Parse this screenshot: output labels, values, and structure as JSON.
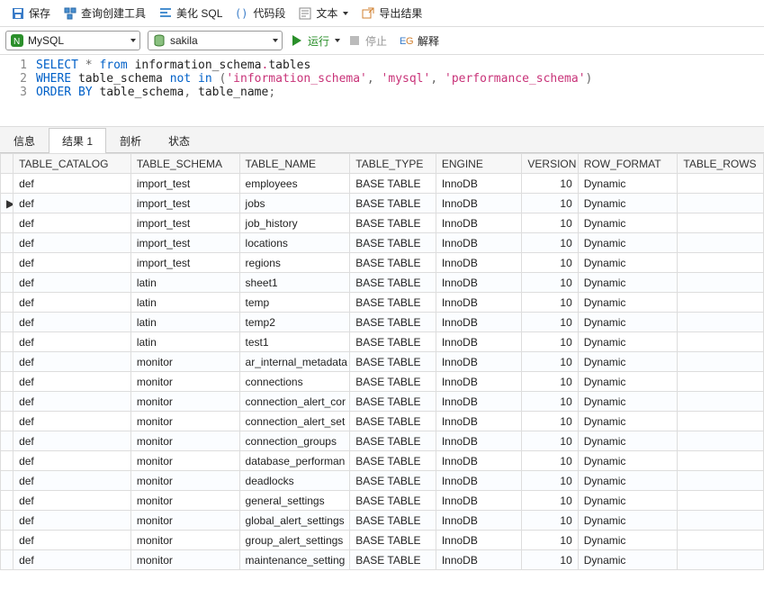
{
  "toolbar": {
    "save": "保存",
    "query_builder": "查询创建工具",
    "beautify_sql": "美化 SQL",
    "code_snippet": "代码段",
    "text": "文本",
    "export_result": "导出结果"
  },
  "row2": {
    "db_type": "MySQL",
    "schema": "sakila",
    "run": "运行",
    "stop": "停止",
    "explain": "解释"
  },
  "sql": {
    "lines": [
      {
        "n": "1",
        "tokens": [
          [
            "kw",
            "SELECT"
          ],
          [
            "op",
            " * "
          ],
          [
            "kw",
            "from"
          ],
          [
            "ident",
            " information_schema"
          ],
          [
            "sym",
            "."
          ],
          [
            "ident",
            "tables"
          ]
        ]
      },
      {
        "n": "2",
        "tokens": [
          [
            "kw",
            "WHERE"
          ],
          [
            "ident",
            " table_schema "
          ],
          [
            "kw",
            "not in"
          ],
          [
            "op",
            " ("
          ],
          [
            "str",
            "'information_schema'"
          ],
          [
            "op",
            ", "
          ],
          [
            "str",
            "'mysql'"
          ],
          [
            "op",
            ", "
          ],
          [
            "str",
            "'performance_schema'"
          ],
          [
            "op",
            ")"
          ]
        ]
      },
      {
        "n": "3",
        "tokens": [
          [
            "kw",
            "ORDER BY"
          ],
          [
            "ident",
            " table_schema"
          ],
          [
            "op",
            ", "
          ],
          [
            "ident",
            "table_name"
          ],
          [
            "op",
            ";"
          ]
        ]
      }
    ]
  },
  "tabs": {
    "info": "信息",
    "result": "结果 1",
    "profile": "剖析",
    "status": "状态"
  },
  "grid": {
    "headers": [
      "TABLE_CATALOG",
      "TABLE_SCHEMA",
      "TABLE_NAME",
      "TABLE_TYPE",
      "ENGINE",
      "VERSION",
      "ROW_FORMAT",
      "TABLE_ROWS"
    ],
    "rows": [
      {
        "ind": "",
        "c": [
          "def",
          "import_test",
          "employees",
          "BASE TABLE",
          "InnoDB",
          "10",
          "Dynamic",
          ""
        ]
      },
      {
        "ind": "▶",
        "c": [
          "def",
          "import_test",
          "jobs",
          "BASE TABLE",
          "InnoDB",
          "10",
          "Dynamic",
          ""
        ]
      },
      {
        "ind": "",
        "c": [
          "def",
          "import_test",
          "job_history",
          "BASE TABLE",
          "InnoDB",
          "10",
          "Dynamic",
          ""
        ]
      },
      {
        "ind": "",
        "c": [
          "def",
          "import_test",
          "locations",
          "BASE TABLE",
          "InnoDB",
          "10",
          "Dynamic",
          ""
        ]
      },
      {
        "ind": "",
        "c": [
          "def",
          "import_test",
          "regions",
          "BASE TABLE",
          "InnoDB",
          "10",
          "Dynamic",
          ""
        ]
      },
      {
        "ind": "",
        "c": [
          "def",
          "latin",
          "sheet1",
          "BASE TABLE",
          "InnoDB",
          "10",
          "Dynamic",
          ""
        ]
      },
      {
        "ind": "",
        "c": [
          "def",
          "latin",
          "temp",
          "BASE TABLE",
          "InnoDB",
          "10",
          "Dynamic",
          ""
        ]
      },
      {
        "ind": "",
        "c": [
          "def",
          "latin",
          "temp2",
          "BASE TABLE",
          "InnoDB",
          "10",
          "Dynamic",
          ""
        ]
      },
      {
        "ind": "",
        "c": [
          "def",
          "latin",
          "test1",
          "BASE TABLE",
          "InnoDB",
          "10",
          "Dynamic",
          ""
        ]
      },
      {
        "ind": "",
        "c": [
          "def",
          "monitor",
          "ar_internal_metadata",
          "BASE TABLE",
          "InnoDB",
          "10",
          "Dynamic",
          ""
        ]
      },
      {
        "ind": "",
        "c": [
          "def",
          "monitor",
          "connections",
          "BASE TABLE",
          "InnoDB",
          "10",
          "Dynamic",
          ""
        ]
      },
      {
        "ind": "",
        "c": [
          "def",
          "monitor",
          "connection_alert_cor",
          "BASE TABLE",
          "InnoDB",
          "10",
          "Dynamic",
          ""
        ]
      },
      {
        "ind": "",
        "c": [
          "def",
          "monitor",
          "connection_alert_set",
          "BASE TABLE",
          "InnoDB",
          "10",
          "Dynamic",
          ""
        ]
      },
      {
        "ind": "",
        "c": [
          "def",
          "monitor",
          "connection_groups",
          "BASE TABLE",
          "InnoDB",
          "10",
          "Dynamic",
          ""
        ]
      },
      {
        "ind": "",
        "c": [
          "def",
          "monitor",
          "database_performan",
          "BASE TABLE",
          "InnoDB",
          "10",
          "Dynamic",
          ""
        ]
      },
      {
        "ind": "",
        "c": [
          "def",
          "monitor",
          "deadlocks",
          "BASE TABLE",
          "InnoDB",
          "10",
          "Dynamic",
          ""
        ]
      },
      {
        "ind": "",
        "c": [
          "def",
          "monitor",
          "general_settings",
          "BASE TABLE",
          "InnoDB",
          "10",
          "Dynamic",
          ""
        ]
      },
      {
        "ind": "",
        "c": [
          "def",
          "monitor",
          "global_alert_settings",
          "BASE TABLE",
          "InnoDB",
          "10",
          "Dynamic",
          ""
        ]
      },
      {
        "ind": "",
        "c": [
          "def",
          "monitor",
          "group_alert_settings",
          "BASE TABLE",
          "InnoDB",
          "10",
          "Dynamic",
          ""
        ]
      },
      {
        "ind": "",
        "c": [
          "def",
          "monitor",
          "maintenance_setting",
          "BASE TABLE",
          "InnoDB",
          "10",
          "Dynamic",
          ""
        ]
      }
    ]
  }
}
